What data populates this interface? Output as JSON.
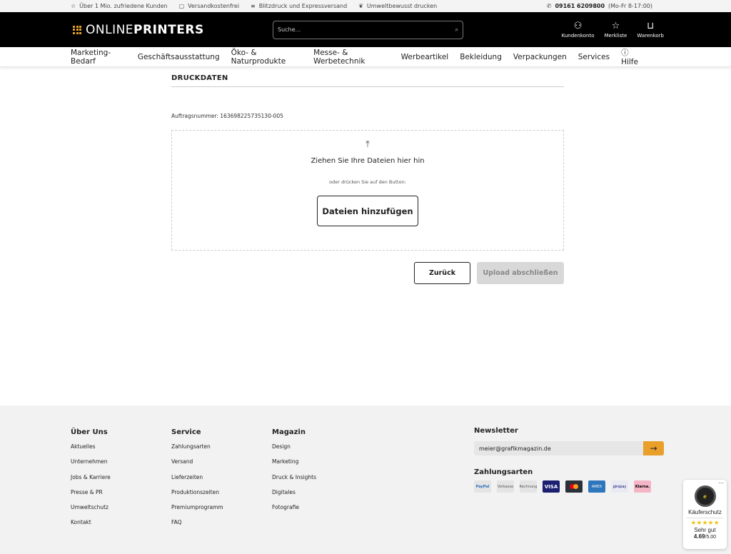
{
  "topbar": {
    "items": [
      "Über 1 Mio. zufriedene Kunden",
      "Versandkostenfrei",
      "Blitzdruck und Expressversand",
      "Umweltbewusst drucken"
    ],
    "phone": "09161 6209800",
    "hours": "(Mo-Fr 8-17:00)"
  },
  "header": {
    "logo_light": "ONLINE",
    "logo_bold": "PRINTERS",
    "search_placeholder": "Suche...",
    "account": "Kundenkonto",
    "wishlist": "Merkliste",
    "cart": "Warenkorb"
  },
  "nav": {
    "items": [
      "Marketing-Bedarf",
      "Geschäftsausstattung",
      "Öko- & Naturprodukte",
      "Messe- & Werbetechnik",
      "Werbeartikel",
      "Bekleidung",
      "Verpackungen",
      "Services"
    ],
    "help": "Hilfe"
  },
  "main": {
    "title": "DRUCKDATEN",
    "order": "Auftragsnummer: 163698225735130-005",
    "drop_text": "Ziehen Sie Ihre Dateien hier hin",
    "drop_sub": "oder drücken Sie auf den Button:",
    "add_files": "Dateien hinzufügen",
    "back": "Zurück",
    "finish": "Upload abschließen"
  },
  "footer": {
    "cols": [
      {
        "title": "Über Uns",
        "links": [
          "Aktuelles",
          "Unternehmen",
          "Jobs & Karriere",
          "Presse & PR",
          "Umweltschutz",
          "Kontakt"
        ]
      },
      {
        "title": "Service",
        "links": [
          "Zahlungsarten",
          "Versand",
          "Lieferzeiten",
          "Produktionszeiten",
          "Premiumprogramm",
          "FAQ"
        ]
      },
      {
        "title": "Magazin",
        "links": [
          "Design",
          "Marketing",
          "Druck & Insights",
          "Digitales",
          "Fotografie"
        ]
      }
    ],
    "newsletter_title": "Newsletter",
    "newsletter_value": "meier@grafikmagazin.de",
    "payments_title": "Zahlungsarten",
    "payments": [
      "PayPal",
      "Vorkasse",
      "Rechnung",
      "VISA",
      "Mastercard",
      "AMEX",
      "giropay",
      "Klarna."
    ]
  },
  "badge": {
    "label": "Käuferschutz",
    "rating_text": "Sehr gut",
    "score": "4.69",
    "max": "/5.00",
    "stars": 5
  },
  "colors": {
    "accent": "#e8a02a",
    "header_bg": "#000000"
  }
}
